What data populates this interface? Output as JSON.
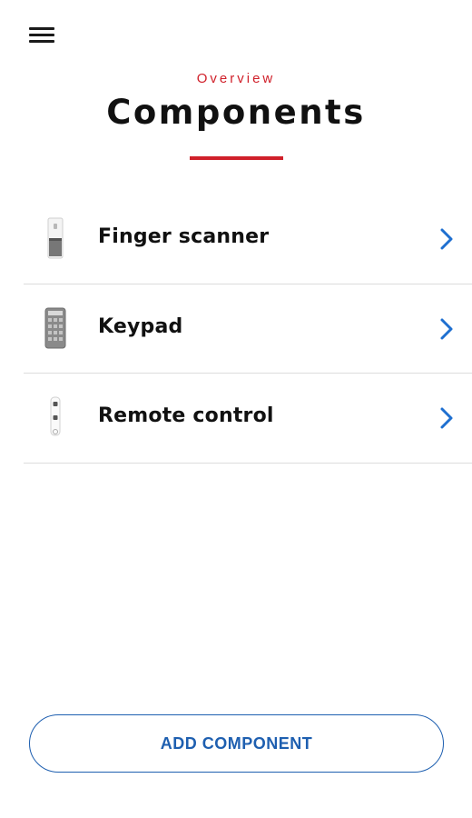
{
  "header": {
    "menu_icon": "hamburger-menu-icon",
    "eyebrow": "Overview",
    "title": "Components"
  },
  "components": [
    {
      "label": "Finger scanner",
      "icon": "finger-scanner-icon"
    },
    {
      "label": "Keypad",
      "icon": "keypad-icon"
    },
    {
      "label": "Remote control",
      "icon": "remote-control-icon"
    }
  ],
  "actions": {
    "add_label": "ADD COMPONENT"
  },
  "colors": {
    "accent_red": "#d0202a",
    "link_blue": "#1e5fb0",
    "divider": "#dcdcdc"
  }
}
